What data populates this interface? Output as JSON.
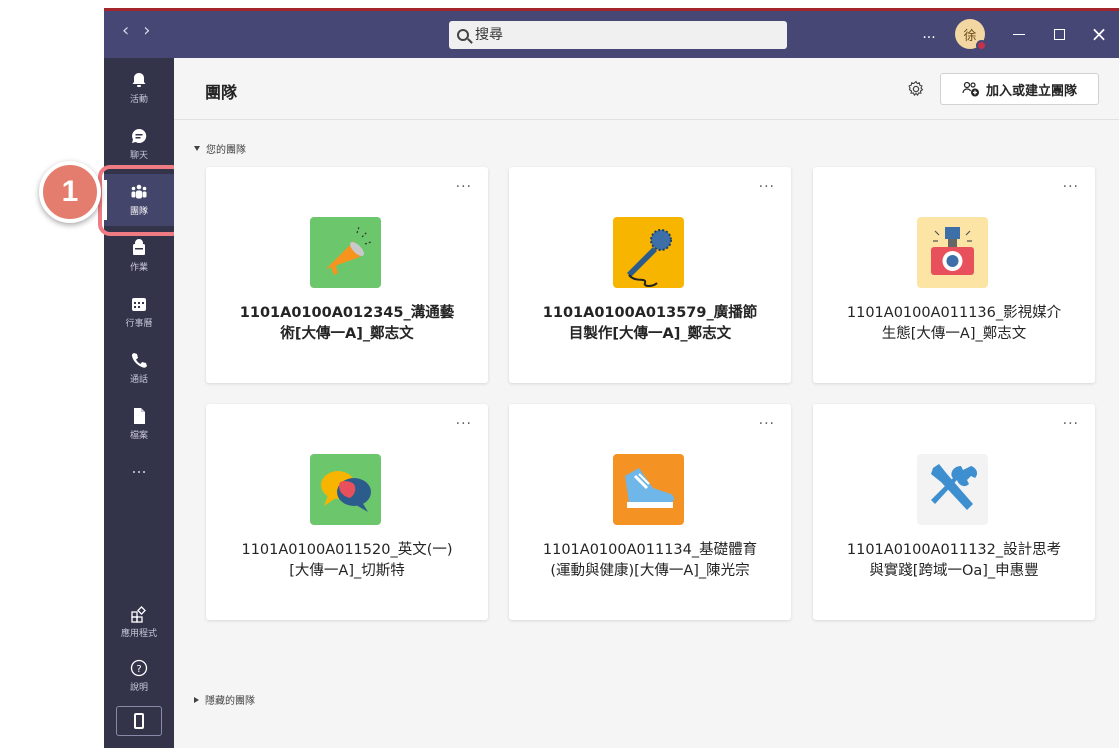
{
  "search": {
    "placeholder": "搜尋"
  },
  "titlebar": {
    "more": "...",
    "avatar_initial": "徐"
  },
  "rail": {
    "items": [
      {
        "label": "活動",
        "icon": "bell-icon"
      },
      {
        "label": "聊天",
        "icon": "chat-icon"
      },
      {
        "label": "團隊",
        "icon": "teams-icon",
        "active": true
      },
      {
        "label": "作業",
        "icon": "backpack-icon"
      },
      {
        "label": "行事曆",
        "icon": "calendar-icon"
      },
      {
        "label": "通話",
        "icon": "phone-call-icon"
      },
      {
        "label": "檔案",
        "icon": "file-icon"
      }
    ],
    "more": "...",
    "apps_label": "應用程式",
    "help_label": "說明"
  },
  "annotation": {
    "step_number": "1",
    "accent": "#ef7b83"
  },
  "main": {
    "title": "團隊",
    "join_button": "加入或建立團隊",
    "your_teams": "您的團隊",
    "hidden_teams": "隱藏的團隊"
  },
  "teams": [
    {
      "line1": "1101A0100A012345_溝通藝",
      "line2": "術[大傳一A]_鄭志文",
      "bold": true,
      "tile_color": "#6cc66c",
      "icon": "megaphone-icon"
    },
    {
      "line1": "1101A0100A013579_廣播節",
      "line2": "目製作[大傳一A]_鄭志文",
      "bold": true,
      "tile_color": "#f7b500",
      "icon": "microphone-icon"
    },
    {
      "line1": "1101A0100A011136_影視媒介",
      "line2": "生態[大傳一A]_鄭志文",
      "bold": false,
      "tile_color": "#fce5a4",
      "icon": "camera-icon"
    },
    {
      "line1": "1101A0100A011520_英文(一)",
      "line2": "[大傳一A]_切斯特",
      "bold": false,
      "tile_color": "#6cc66c",
      "icon": "speech-bubbles-icon"
    },
    {
      "line1": "1101A0100A011134_基礎體育",
      "line2": "(運動與健康)[大傳一A]_陳光宗",
      "bold": false,
      "tile_color": "#f59224",
      "icon": "sneaker-icon"
    },
    {
      "line1": "1101A0100A011132_設計思考",
      "line2": "與實踐[跨域一Oa]_申惠豐",
      "bold": false,
      "tile_color": "#f3f3f3",
      "icon": "tools-icon"
    }
  ]
}
